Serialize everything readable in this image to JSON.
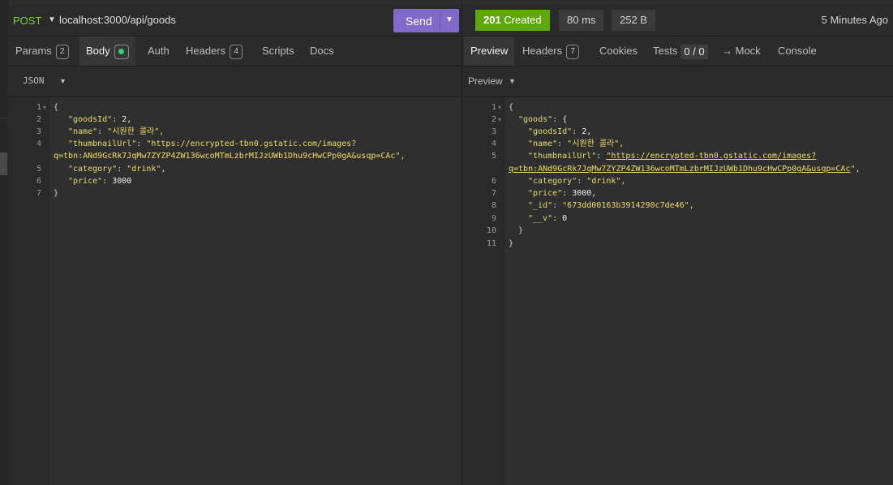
{
  "request": {
    "method": "POST",
    "url": "localhost:3000/api/goods",
    "send_label": "Send"
  },
  "response": {
    "status_code": "201",
    "status_text": "Created",
    "time": "80 ms",
    "size": "252 B",
    "ago": "5 Minutes Ago"
  },
  "left_tabs": {
    "params": "Params",
    "params_count": "2",
    "body": "Body",
    "auth": "Auth",
    "headers": "Headers",
    "headers_count": "4",
    "scripts": "Scripts",
    "docs": "Docs"
  },
  "right_tabs": {
    "preview": "Preview",
    "headers": "Headers",
    "headers_count": "7",
    "cookies": "Cookies",
    "tests": "Tests",
    "tests_count": "0 / 0",
    "mock": "→ Mock",
    "console": "Console"
  },
  "left_sub": {
    "mode": "JSON"
  },
  "right_sub": {
    "mode": "Preview"
  },
  "request_body": {
    "l1": "{",
    "l2_key": "\"goodsId\"",
    "l2_val": "2,",
    "l3_key": "\"name\"",
    "l3_val": "\"시원한 콜라\",",
    "l4_key": "\"thumbnailUrl\"",
    "l4_val": "\"https://encrypted-tbn0.gstatic.com/images?",
    "l4_wrap": "q=tbn:ANd9GcRk7JqMw7ZYZP4ZW136wcoMTmLzbrMIJzUWb1Dhu9cHwCPp0gA&usqp=CAc\",",
    "l5_key": "\"category\"",
    "l5_val": "\"drink\",",
    "l6_key": "\"price\"",
    "l6_val": "3000",
    "l7": "}"
  },
  "response_body": {
    "l1": "{",
    "l2_key": "\"goods\"",
    "l2_val": "{",
    "l3_key": "\"goodsId\"",
    "l3_val": "2,",
    "l4_key": "\"name\"",
    "l4_val": "\"시원한 콜라\",",
    "l5_key": "\"thumbnailUrl\"",
    "l5_val": "\"https://encrypted-tbn0.gstatic.com/images?",
    "l5_wrap": "q=tbn:ANd9GcRk7JqMw7ZYZP4ZW136wcoMTmLzbrMIJzUWb1Dhu9cHwCPp0gA&usqp=CAc",
    "l5_wrap_end": "\",",
    "l6_key": "\"category\"",
    "l6_val": "\"drink\",",
    "l7_key": "\"price\"",
    "l7_val": "3000,",
    "l8_key": "\"_id\"",
    "l8_val": "\"673dd00163b3914290c7de46\",",
    "l9_key": "\"__v\"",
    "l9_val": "0",
    "l10": "}",
    "l11": "}"
  }
}
